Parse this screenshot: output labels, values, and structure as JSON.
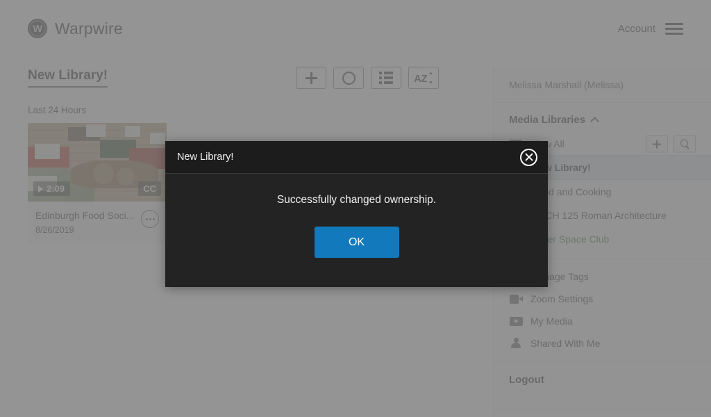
{
  "header": {
    "brand_mark": "W",
    "brand_name": "Warpwire",
    "account_label": "Account",
    "menu_icon": "hamburger-icon"
  },
  "main": {
    "page_title": "New Library!",
    "section_label": "Last 24 Hours",
    "toolbar": [
      {
        "name": "add-button",
        "icon": "plus-icon"
      },
      {
        "name": "record-button",
        "icon": "circle-icon"
      },
      {
        "name": "list-view-button",
        "icon": "list-icon"
      },
      {
        "name": "sort-button",
        "icon": "az-sort-icon"
      }
    ],
    "cards": [
      {
        "title": "Edinburgh Food Soci...",
        "date": "8/26/2019",
        "duration": "2:09",
        "cc": "CC",
        "more_icon": "ellipsis-icon"
      }
    ]
  },
  "sidebar": {
    "user": "Melissa Marshall (Melissa)",
    "section_title": "Media Libraries",
    "collapse_icon": "chevron-up-icon",
    "view_all": "View All",
    "add_library_icon": "plus-icon",
    "search_library_icon": "search-icon",
    "libraries": [
      {
        "label": "New Library!",
        "active": true,
        "color": "#3d3d3d"
      },
      {
        "label": "Food and Cooking",
        "active": false,
        "color": "#4a4a4a"
      },
      {
        "label": "ARCH 125 Roman Architecture",
        "active": false,
        "color": "#4a4a4a"
      },
      {
        "label": "Outer Space Club",
        "active": false,
        "color": "#3f8a45"
      }
    ],
    "links": [
      {
        "label": "Manage Tags",
        "icon": "tag-icon"
      },
      {
        "label": "Zoom Settings",
        "icon": "video-camera-icon"
      },
      {
        "label": "My Media",
        "icon": "play-rect-icon"
      },
      {
        "label": "Shared With Me",
        "icon": "person-icon"
      }
    ],
    "logout": "Logout"
  },
  "modal": {
    "title": "New Library!",
    "message": "Successfully changed ownership.",
    "ok_label": "OK",
    "close_icon": "close-circle-icon",
    "accent_color": "#1379bd",
    "background_color": "#232323"
  }
}
